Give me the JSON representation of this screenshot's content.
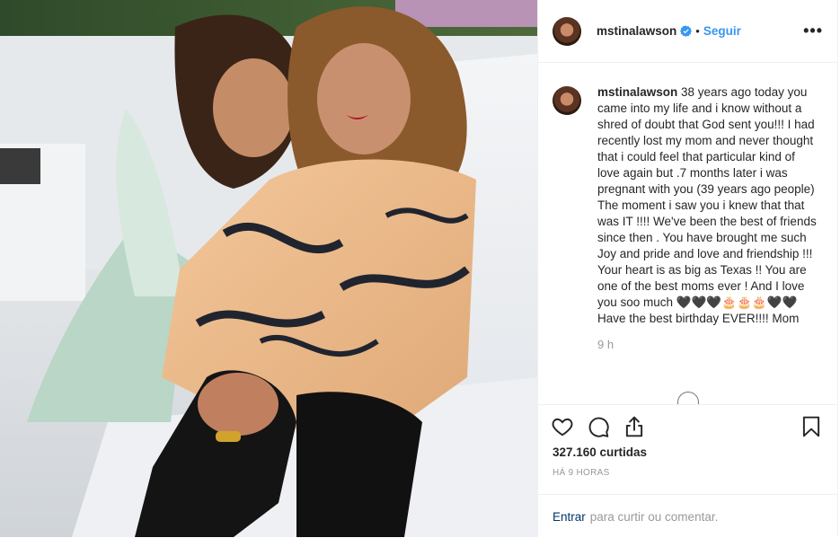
{
  "post": {
    "username": "mstinalawson",
    "follow_label": "Seguir",
    "more_label": "•••",
    "caption_user": "mstinalawson",
    "caption_text": " 38 years ago today you came into my life and i know without a shred of doubt that God sent you!!! I had recently lost my mom and never thought that i could feel that particular kind of love again but .7 months later i was pregnant with you (39 years ago people) The moment i saw you i knew that that was IT !!!! We've been the best of friends since then . You have brought me such Joy and pride and love and friendship !!! Your heart is as big as Texas !! You are one of the best moms ever ! And I love you soo much 🖤🖤🖤🎂🎂🎂🖤🖤Have the best birthday EVER!!!! Mom",
    "relative_time": "9 h",
    "likes": "327.160 curtidas",
    "timestamp": "HÁ 9 HORAS",
    "login_link": "Entrar",
    "comment_prompt": "para curtir ou comentar."
  },
  "icons": {
    "verified": "verified-badge-icon",
    "like": "heart-icon",
    "comment": "comment-bubble-icon",
    "share": "share-icon",
    "save": "bookmark-icon",
    "more": "more-options-icon"
  },
  "colors": {
    "link_blue": "#3897f0",
    "login_blue": "#003569",
    "text": "#262626",
    "muted": "#999999",
    "border": "#efefef"
  }
}
